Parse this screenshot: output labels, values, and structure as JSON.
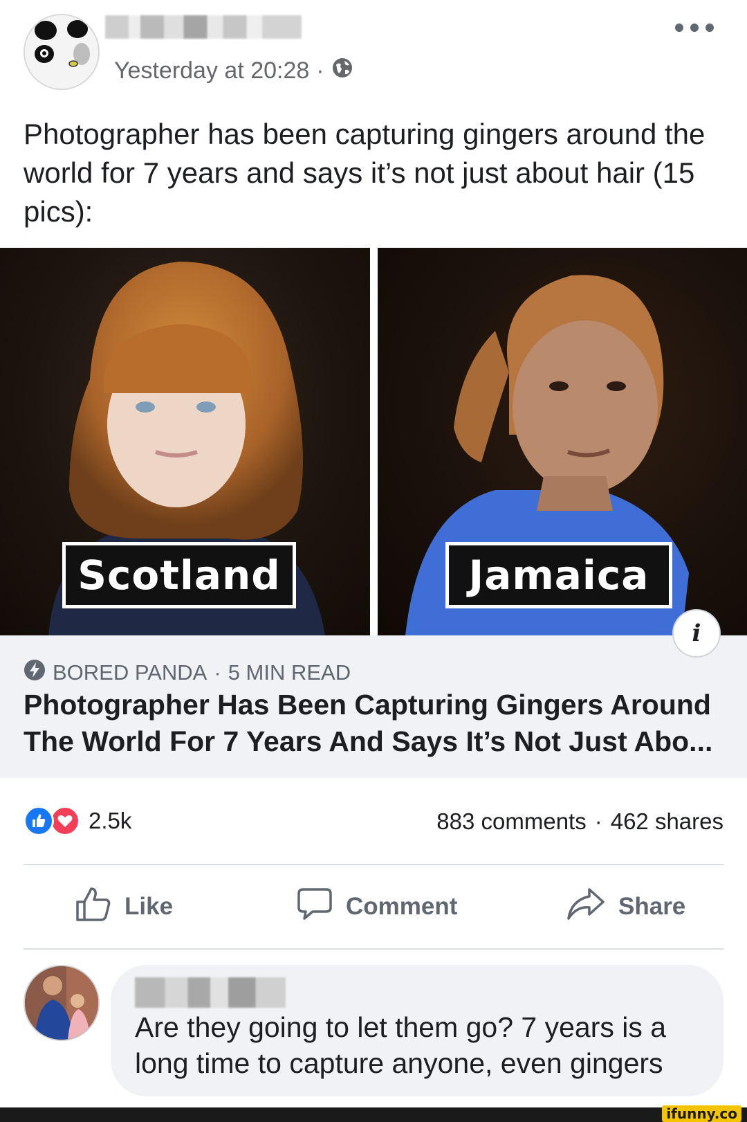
{
  "post": {
    "timestamp": "Yesterday at 20:28",
    "separator": "·",
    "privacy_icon": "globe-icon",
    "text": "Photographer has been capturing gingers around the world for 7 years and says it’s not just about hair (15 pics):"
  },
  "photos": {
    "left_label": "Scotland",
    "right_label": "Jamaica"
  },
  "link_preview": {
    "source": "BORED PANDA",
    "read_time": "5 MIN READ",
    "separator": "·",
    "title": "Photographer Has Been Capturing Gingers Around The World For 7 Years And Says It’s Not Just Abo...",
    "source_icon": "lightning-icon",
    "info_glyph": "i"
  },
  "stats": {
    "reaction_count": "2.5k",
    "comments": "883 comments",
    "separator": "·",
    "shares": "462 shares"
  },
  "actions": {
    "like": "Like",
    "comment": "Comment",
    "share": "Share"
  },
  "comment": {
    "text": "Are they going to let them go? 7 years is a long time to capture anyone, even gingers"
  },
  "watermark": "ifunny.co",
  "colors": {
    "like_blue": "#1877f2",
    "love_red": "#f33e58",
    "secondary_text": "#65676b",
    "preview_bg": "#f0f2f5"
  }
}
